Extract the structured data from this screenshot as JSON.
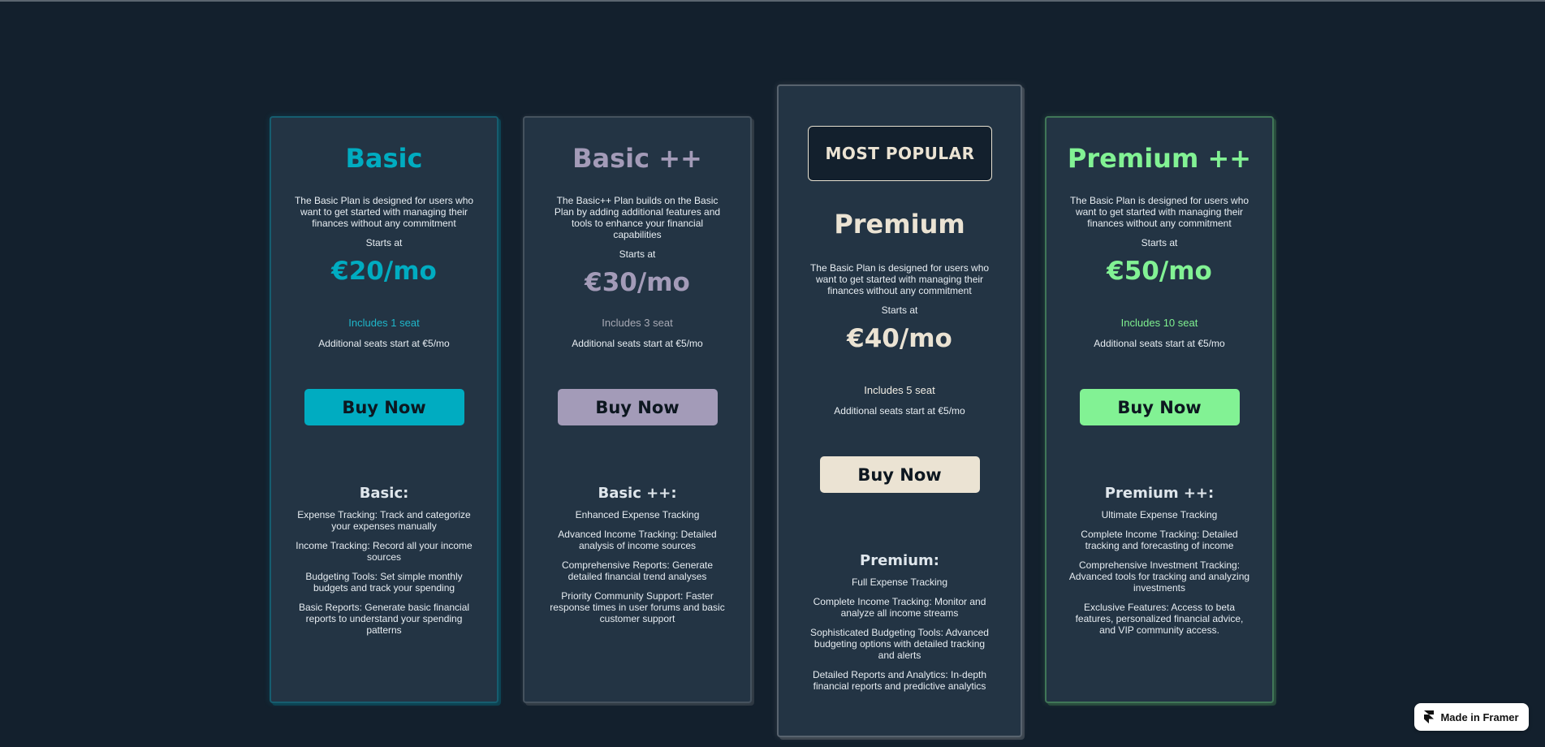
{
  "colors": {
    "background": "#13202d",
    "card": "#233444",
    "basic": "#00acc1",
    "basic_pp": "#a39bb8",
    "premium": "#ebe3d3",
    "premium_pp": "#82f294"
  },
  "plans": {
    "basic": {
      "name": "Basic",
      "description": "The Basic Plan is designed for users who want to get started with managing their finances without any commitment",
      "starts_at": "Starts at",
      "price": "€20/mo",
      "seats": "Includes 1 seat",
      "additional": "Additional seats start at €5/mo",
      "buy_label": "Buy Now",
      "features_title": "Basic:",
      "features": [
        "Expense Tracking: Track and categorize your expenses manually",
        "Income Tracking: Record all your income sources",
        "Budgeting Tools: Set simple monthly budgets and track your spending",
        "Basic Reports: Generate basic financial reports to understand your spending patterns"
      ]
    },
    "basic_pp": {
      "name": "Basic ++",
      "description": "The Basic++ Plan builds on the Basic Plan by adding additional features and tools to enhance your financial capabilities",
      "starts_at": "Starts at",
      "price": "€30/mo",
      "seats": "Includes 3 seat",
      "additional": "Additional seats start at €5/mo",
      "buy_label": "Buy Now",
      "features_title": "Basic ++:",
      "features": [
        "Enhanced Expense Tracking",
        "Advanced Income Tracking: Detailed analysis of income sources",
        "Comprehensive Reports: Generate detailed financial trend analyses",
        "Priority Community Support: Faster response times in user forums and basic customer support"
      ]
    },
    "premium": {
      "badge": "MOST POPULAR",
      "name": "Premium",
      "description": "The Basic Plan is designed for users who want to get started with managing their finances without any commitment",
      "starts_at": "Starts at",
      "price": "€40/mo",
      "seats": "Includes 5 seat",
      "additional": "Additional seats start at €5/mo",
      "buy_label": "Buy Now",
      "features_title": "Premium:",
      "features": [
        "Full Expense Tracking",
        "Complete Income Tracking: Monitor and analyze all income streams",
        "Sophisticated Budgeting Tools: Advanced budgeting options with detailed tracking and alerts",
        "Detailed Reports and Analytics: In-depth financial reports and predictive analytics"
      ]
    },
    "premium_pp": {
      "name": "Premium ++",
      "description": "The Basic Plan is designed for users who want to get started with managing their finances without any commitment",
      "starts_at": "Starts at",
      "price": "€50/mo",
      "seats": "Includes 10 seat",
      "additional": "Additional seats start at €5/mo",
      "buy_label": "Buy Now",
      "features_title": "Premium ++:",
      "features": [
        "Ultimate Expense Tracking",
        "Complete Income Tracking: Detailed tracking and forecasting of income",
        "Comprehensive Investment Tracking: Advanced tools for tracking and analyzing investments",
        "Exclusive Features: Access to beta features, personalized financial advice, and VIP community access."
      ]
    }
  },
  "framer_badge": {
    "label": "Made in Framer",
    "icon": "framer-logo-icon"
  }
}
